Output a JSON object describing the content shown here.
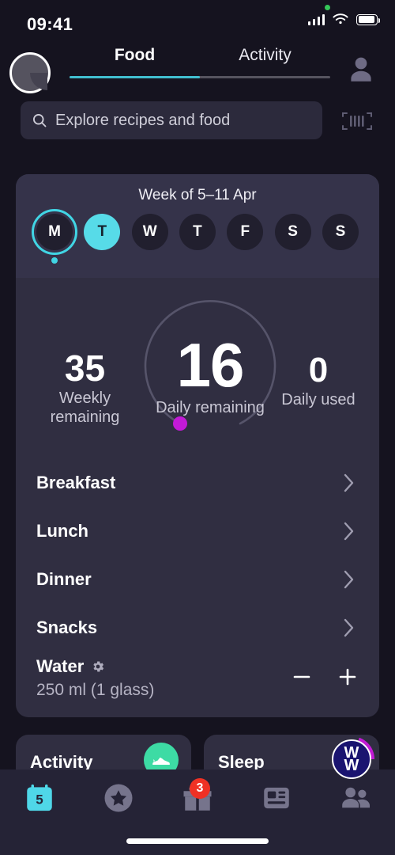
{
  "status_bar": {
    "time": "09:41",
    "icons": [
      "green-dot",
      "cellular-signal",
      "wifi",
      "battery"
    ]
  },
  "header": {
    "avatar_icon": "avatar-circle",
    "bell_icon": "bell-icon",
    "profile_icon": "person-icon",
    "tabs": [
      {
        "label": "Food",
        "active": true
      },
      {
        "label": "Activity",
        "active": false
      }
    ]
  },
  "search": {
    "placeholder": "Explore recipes and food",
    "value": "",
    "icon": "search-icon",
    "barcode_icon": "barcode-scanner-icon"
  },
  "week": {
    "title": "Week of 5–11 Apr",
    "days": [
      {
        "letter": "M",
        "today": true,
        "selected": false,
        "has_dot": true
      },
      {
        "letter": "T",
        "today": false,
        "selected": true,
        "has_dot": false
      },
      {
        "letter": "W",
        "today": false,
        "selected": false,
        "has_dot": false
      },
      {
        "letter": "T",
        "today": false,
        "selected": false,
        "has_dot": false
      },
      {
        "letter": "F",
        "today": false,
        "selected": false,
        "has_dot": false
      },
      {
        "letter": "S",
        "today": false,
        "selected": false,
        "has_dot": false
      },
      {
        "letter": "S",
        "today": false,
        "selected": false,
        "has_dot": false
      }
    ]
  },
  "points": {
    "weekly_remaining_value": "35",
    "weekly_remaining_label": "Weekly remaining",
    "daily_remaining_value": "16",
    "daily_remaining_label": "Daily remaining",
    "daily_used_value": "0",
    "daily_used_label": "Daily used",
    "ring_track_color": "#56546a",
    "ring_marker_color": "#c21ad6"
  },
  "meals": [
    {
      "name": "Breakfast",
      "chevron": "chevron-right-icon"
    },
    {
      "name": "Lunch",
      "chevron": "chevron-right-icon"
    },
    {
      "name": "Dinner",
      "chevron": "chevron-right-icon"
    },
    {
      "name": "Snacks",
      "chevron": "chevron-right-icon"
    }
  ],
  "water": {
    "name": "Water",
    "settings_icon": "gear-icon",
    "amount": "250 ml (1 glass)",
    "minus_label": "−",
    "plus_label": "+"
  },
  "lower_cards": [
    {
      "title": "Activity",
      "badge_icon": "sneaker-icon",
      "badge_color": "#3ddba4"
    },
    {
      "title": "Sleep",
      "badge_icon": "ww-logo",
      "badge_color": "#1a1470"
    }
  ],
  "bottom_nav": [
    {
      "name": "calendar",
      "icon": "calendar-icon",
      "date": "5",
      "active": true,
      "badge": ""
    },
    {
      "name": "favorites",
      "icon": "star-circle-icon",
      "active": false,
      "badge": ""
    },
    {
      "name": "rewards",
      "icon": "gift-icon",
      "active": false,
      "badge": "3"
    },
    {
      "name": "articles",
      "icon": "article-icon",
      "active": false,
      "badge": ""
    },
    {
      "name": "community",
      "icon": "people-icon",
      "active": false,
      "badge": ""
    }
  ],
  "colors": {
    "accent": "#41d5e4",
    "background": "#15131f",
    "card": "#302e41",
    "badge_red": "#ef3124"
  }
}
